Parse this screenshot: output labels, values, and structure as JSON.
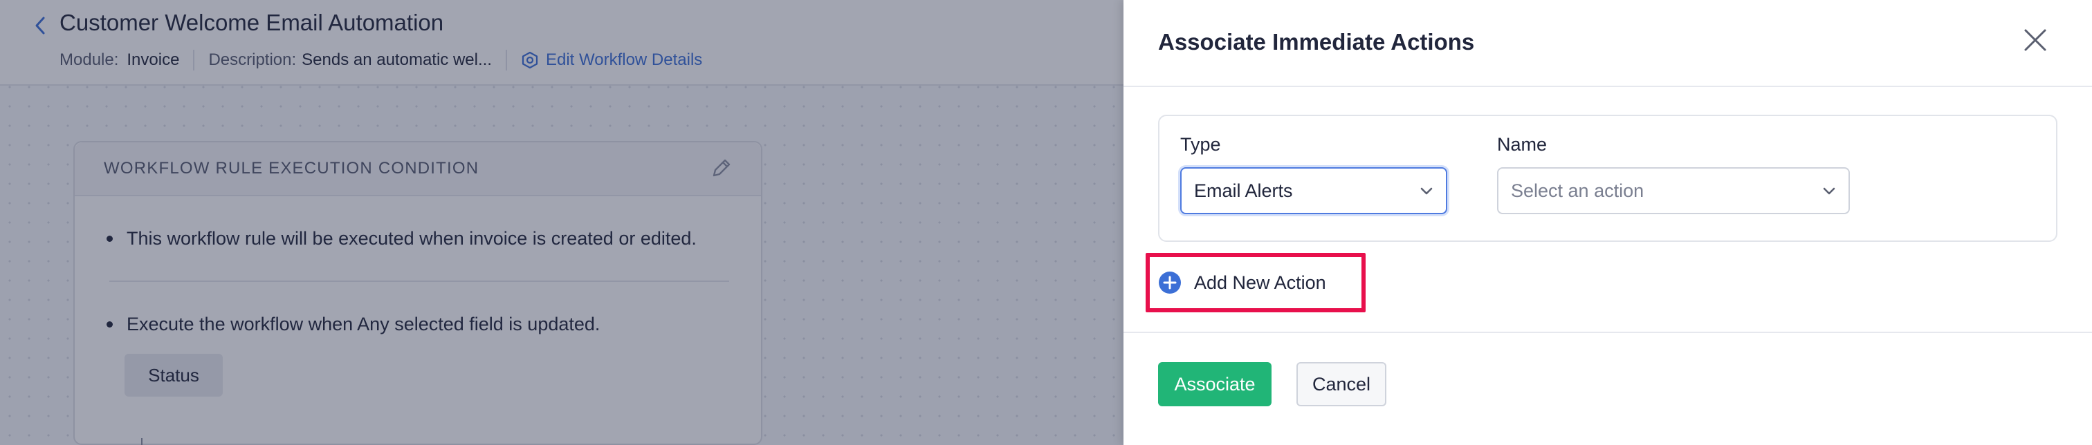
{
  "background": {
    "header": {
      "title": "Customer Welcome Email Automation",
      "back_icon": "chevron-left-icon",
      "module_label": "Module:",
      "module_value": "Invoice",
      "description_label": "Description:",
      "description_value": "Sends an automatic wel...",
      "edit_link": "Edit Workflow Details",
      "edit_icon": "gear-hexagon-icon"
    },
    "condition_card": {
      "title": "WORKFLOW RULE EXECUTION CONDITION",
      "edit_icon": "pencil-icon",
      "bullet_1": "This workflow rule will be executed when invoice is created or edited.",
      "bullet_2": "Execute the workflow when Any selected field is updated.",
      "chip": "Status"
    }
  },
  "panel": {
    "title": "Associate Immediate Actions",
    "close_icon": "close-icon",
    "type_label": "Type",
    "type_value": "Email Alerts",
    "name_label": "Name",
    "name_placeholder": "Select an action",
    "add_action_label": "Add New Action",
    "add_action_icon": "plus-circle-icon",
    "associate_button": "Associate",
    "cancel_button": "Cancel"
  },
  "colors": {
    "accent_blue": "#3c6fd6",
    "primary_green": "#21b577",
    "highlight_red": "#e8104c",
    "overlay": "rgba(34,40,70,0.42)"
  }
}
